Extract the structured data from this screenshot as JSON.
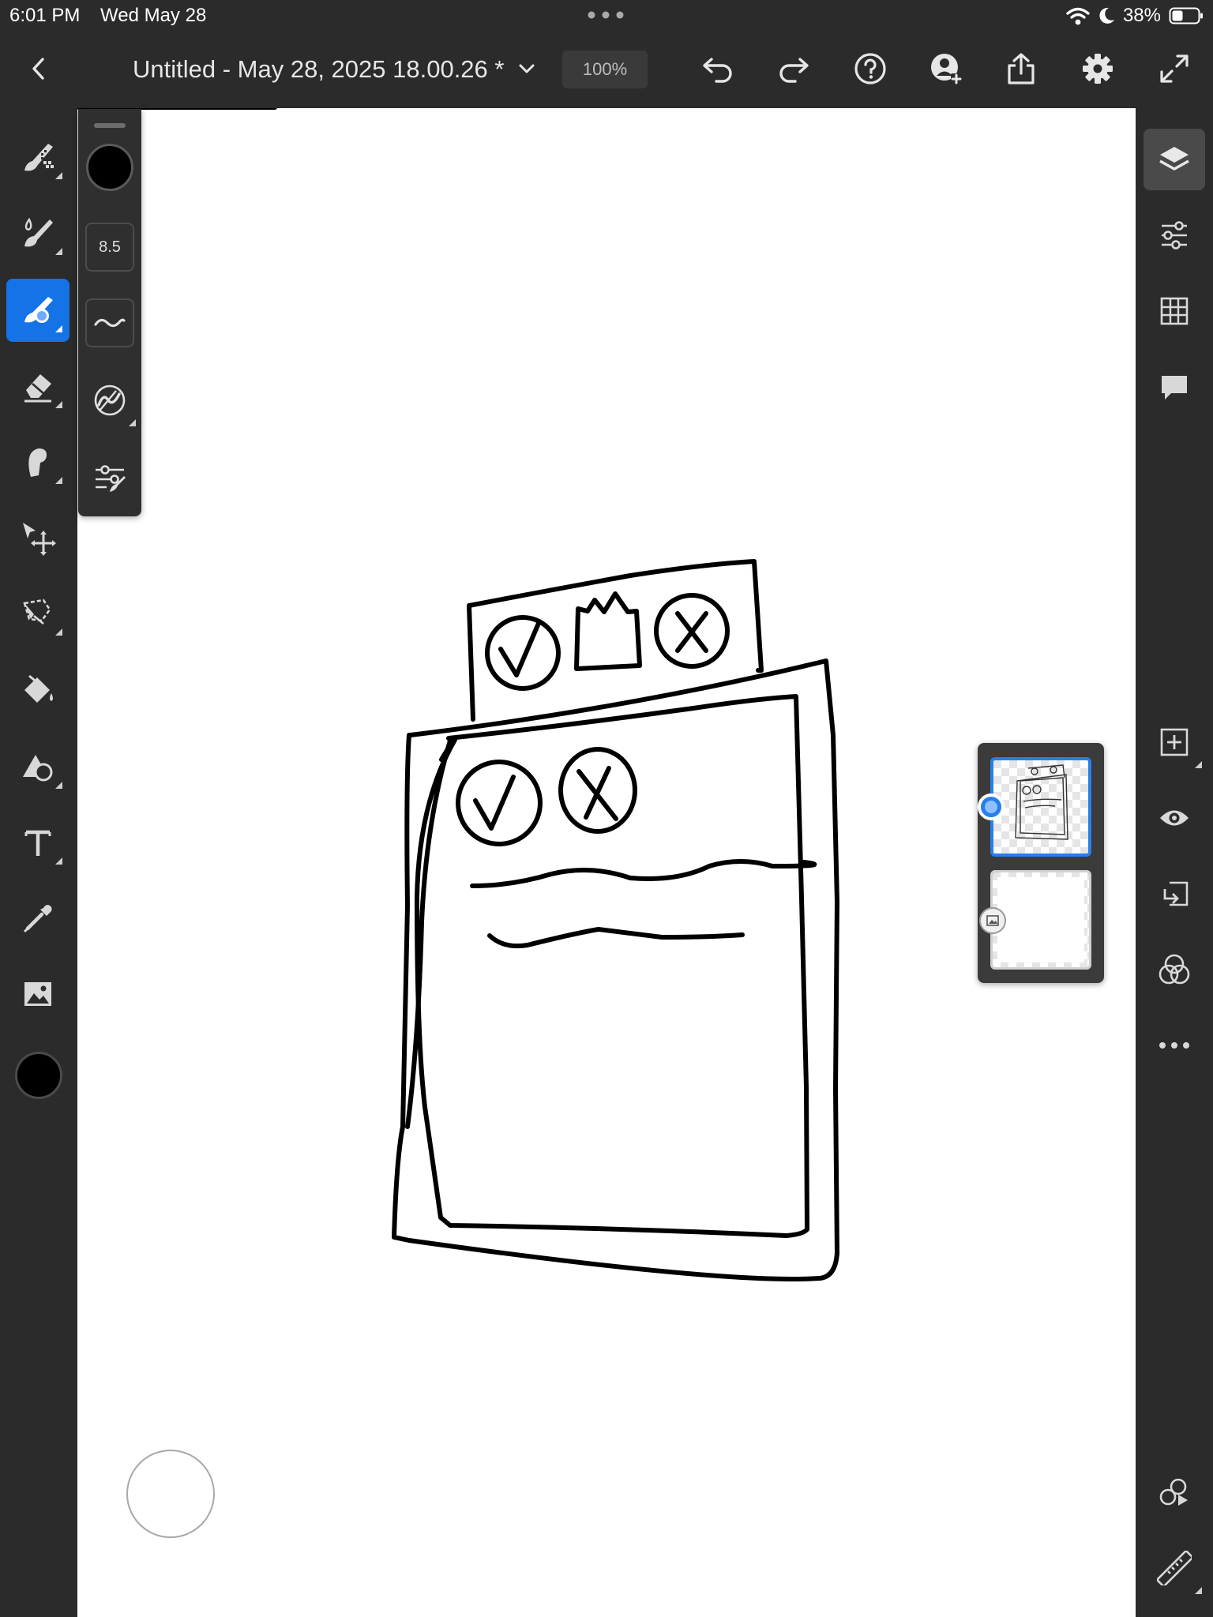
{
  "status": {
    "time": "6:01 PM",
    "date": "Wed May 28",
    "battery": "38%"
  },
  "toolbar": {
    "doc_title": "Untitled - May 28, 2025 18.00.26 *",
    "zoom": "100%"
  },
  "brush_panel": {
    "size": "8.5",
    "color": "#000000"
  },
  "left_tools": [
    {
      "name": "pixel-brush-tool",
      "icon": "pixel-brush-icon"
    },
    {
      "name": "live-brush-tool",
      "icon": "live-brush-icon"
    },
    {
      "name": "vector-brush-tool",
      "icon": "vector-brush-icon",
      "active": true
    },
    {
      "name": "eraser-tool",
      "icon": "eraser-icon"
    },
    {
      "name": "smudge-tool",
      "icon": "smudge-icon"
    },
    {
      "name": "transform-tool",
      "icon": "move-icon"
    },
    {
      "name": "selection-tool",
      "icon": "lasso-icon"
    },
    {
      "name": "fill-tool",
      "icon": "paint-bucket-icon"
    },
    {
      "name": "shape-tool",
      "icon": "shape-icon"
    },
    {
      "name": "text-tool",
      "icon": "text-icon"
    },
    {
      "name": "eyedropper-tool",
      "icon": "eyedropper-icon"
    },
    {
      "name": "image-tool",
      "icon": "image-icon"
    }
  ],
  "colors": {
    "accent": "#1473e6",
    "layer_selected": "#2680eb",
    "chrome": "#2b2b2b",
    "canvas": "#ffffff",
    "ink": "#000000"
  }
}
